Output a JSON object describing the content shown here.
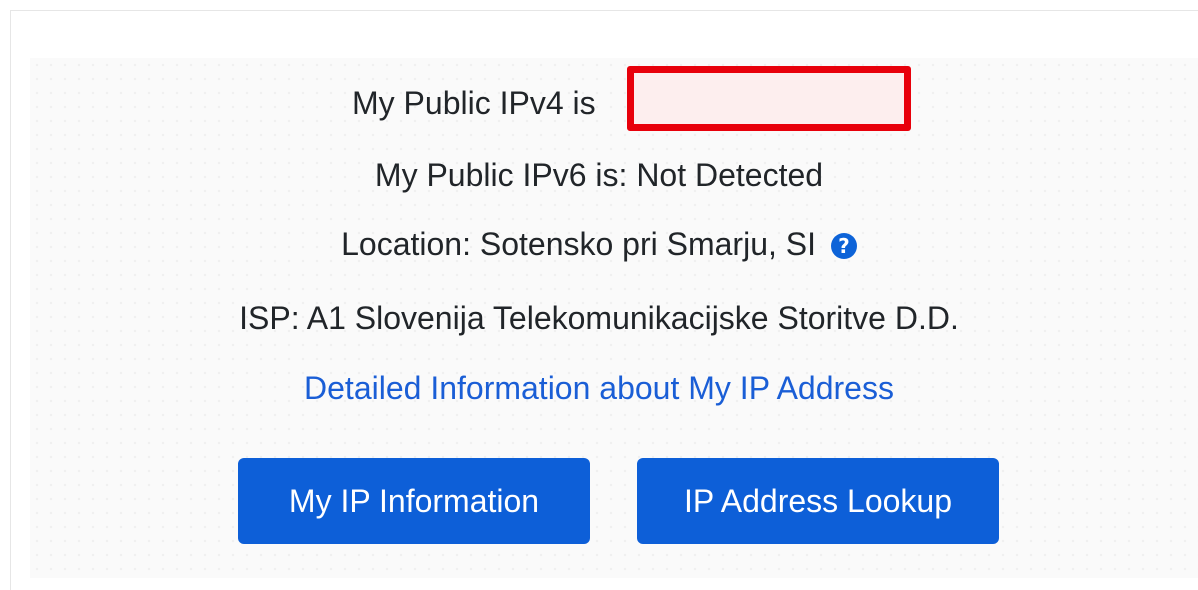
{
  "ipv4": {
    "label": "My Public IPv4 is"
  },
  "ipv6": {
    "text": "My Public IPv6 is: Not Detected"
  },
  "location": {
    "text": "Location: Sotensko pri Smarju, SI",
    "help_icon_glyph": "?",
    "help_icon": "question-circle-icon"
  },
  "isp": {
    "text": "ISP: A1 Slovenija Telekomunikacijske Storitve D.D."
  },
  "detail_link": {
    "text": "Detailed Information about My IP Address"
  },
  "buttons": {
    "info_label": "My IP Information",
    "lookup_label": "IP Address Lookup"
  },
  "colors": {
    "primary": "#0d5fd8",
    "link": "#1a5ed6",
    "redaction_border": "#e8000b"
  }
}
